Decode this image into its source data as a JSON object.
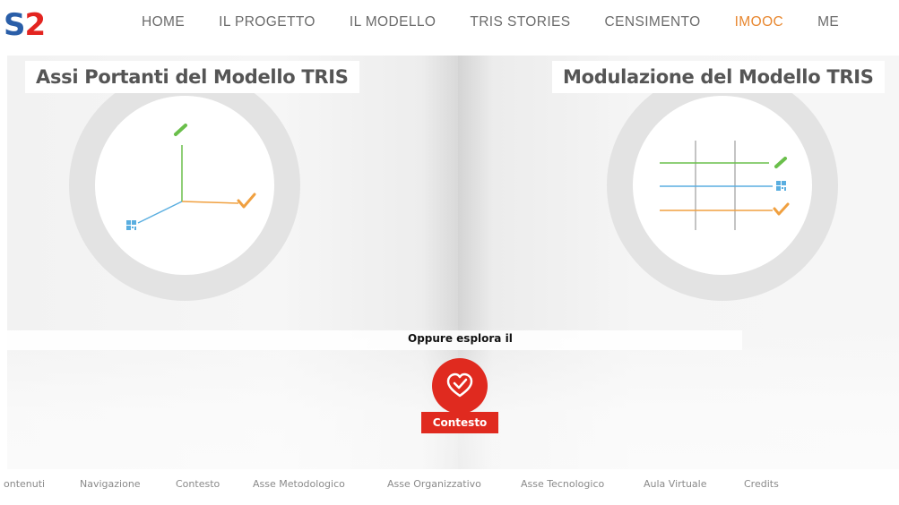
{
  "header": {
    "logo_part1": "S",
    "logo_part2": "2",
    "nav": [
      {
        "label": "HOME"
      },
      {
        "label": "IL PROGETTO"
      },
      {
        "label": "IL MODELLO"
      },
      {
        "label": "TRIS STORIES"
      },
      {
        "label": "CENSIMENTO"
      },
      {
        "label": "IMOOC",
        "active": true
      },
      {
        "label": "ME"
      }
    ]
  },
  "panels": {
    "left": {
      "title": "Assi Portanti del Modello TRIS"
    },
    "right": {
      "title": "Modulazione del Modello TRIS"
    }
  },
  "explore": {
    "label": "Oppure esplora il",
    "button": "Contesto"
  },
  "footer_nav": [
    {
      "label": "ontenuti"
    },
    {
      "label": "Navigazione"
    },
    {
      "label": "Contesto"
    },
    {
      "label": "Asse Metodologico"
    },
    {
      "label": "Asse Organizzativo"
    },
    {
      "label": "Asse Tecnologico"
    },
    {
      "label": "Aula Virtuale"
    },
    {
      "label": "Credits"
    }
  ],
  "colors": {
    "accent": "#e8872f",
    "brand_red": "#e02a1f",
    "brand_blue": "#2a5ea8",
    "axis_green": "#6abf4b",
    "axis_orange": "#f0a040",
    "axis_blue": "#5aaee0"
  },
  "icons": {
    "pen": "pencil-icon",
    "check": "checkmark-icon",
    "qr": "qr-code-icon",
    "heart": "heart-icon"
  }
}
